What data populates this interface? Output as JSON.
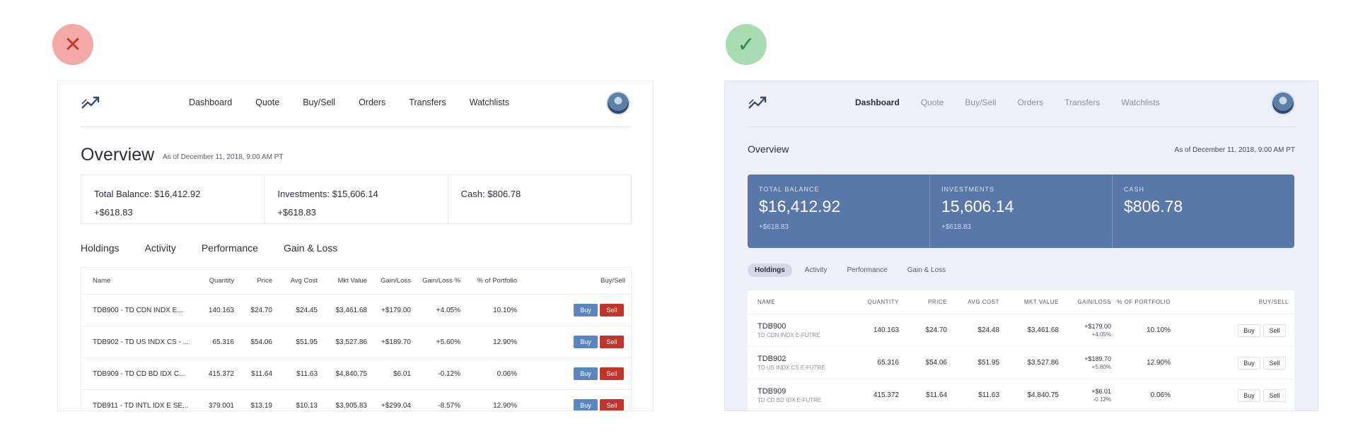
{
  "bad_badge": "✕",
  "good_badge": "✓",
  "colors": {
    "bad_accent": "#c0352b",
    "good_accent": "#5778a8",
    "buy": "#5c86c0",
    "sell": "#c0352b"
  },
  "nav": [
    "Dashboard",
    "Quote",
    "Buy/Sell",
    "Orders",
    "Transfers",
    "Watchlists"
  ],
  "left": {
    "title": "Overview",
    "as_of": "As of December 11, 2018, 9:00 AM PT",
    "balances": [
      {
        "text": "Total Balance: $16,412.92",
        "change": "+$618.83"
      },
      {
        "text": "Investments: $15,606.14",
        "change": "+$618.83"
      },
      {
        "text": "Cash: $806.78",
        "change": ""
      }
    ],
    "tabs": [
      "Holdings",
      "Activity",
      "Performance",
      "Gain & Loss"
    ],
    "headers": [
      "Name",
      "Quantity",
      "Price",
      "Avg Cost",
      "Mkt Value",
      "Gain/Loss",
      "Gain/Loss %",
      "% of Portfolio",
      "Buy/Sell"
    ],
    "rows": [
      [
        "TDB900 - TD CDN INDX E...",
        "140.163",
        "$24.70",
        "$24.45",
        "$3,461.68",
        "+$179.00",
        "+4.05%",
        "10.10%"
      ],
      [
        "TDB902 - TD US INDX CS - ...",
        "65.316",
        "$54.06",
        "$51.95",
        "$3,527.86",
        "+$189.70",
        "+5.60%",
        "12.90%"
      ],
      [
        "TDB909 - TD CD BD IDX C...",
        "415.372",
        "$11.64",
        "$11.63",
        "$4,840.75",
        "$6.01",
        "-0.12%",
        "0.06%"
      ],
      [
        "TDB911 - TD INTL IDX E SE...",
        "379.001",
        "$13.19",
        "$10.13",
        "$3,905.83",
        "+$299.04",
        "-8.57%",
        "12.90%"
      ]
    ],
    "buy_label": "Buy",
    "sell_label": "Sell"
  },
  "right": {
    "title": "Overview",
    "as_of": "As of December 11, 2018, 9:00 AM PT",
    "balances": [
      {
        "label": "TOTAL BALANCE",
        "amount": "$16,412.92",
        "change": "+$618.83"
      },
      {
        "label": "INVESTMENTS",
        "amount": "15,606.14",
        "change": "+$618.83"
      },
      {
        "label": "CASH",
        "amount": "$806.78",
        "change": ""
      }
    ],
    "tabs": [
      "Holdings",
      "Activity",
      "Performance",
      "Gain & Loss"
    ],
    "headers": [
      "NAME",
      "QUANTITY",
      "PRICE",
      "AVG COST",
      "MKT VALUE",
      "GAIN/LOSS",
      "% OF PORTFOLIO",
      "BUY/SELL"
    ],
    "rows": [
      {
        "symbol": "TDB900",
        "name": "TD CDN INDX E-FUTRE",
        "quantity": "140.163",
        "price": "$24.70",
        "avg_cost": "$24.48",
        "mkt_value": "$3,461.68",
        "gain": "+$179.00",
        "gain_pct": "+4.05%",
        "portfolio": "10.10%"
      },
      {
        "symbol": "TDB902",
        "name": "TD US INDX CS E-FUTRE",
        "quantity": "65.316",
        "price": "$54.06",
        "avg_cost": "$51.95",
        "mkt_value": "$3,527.86",
        "gain": "+$189.70",
        "gain_pct": "+5.60%",
        "portfolio": "12.90%"
      },
      {
        "symbol": "TDB909",
        "name": "TD CD BD IDX E-FUTRE",
        "quantity": "415.372",
        "price": "$11.64",
        "avg_cost": "$11.63",
        "mkt_value": "$4,840.75",
        "gain": "+$6.01",
        "gain_pct": "-0.12%",
        "portfolio": "0.06%"
      }
    ],
    "buy_label": "Buy",
    "sell_label": "Sell"
  }
}
